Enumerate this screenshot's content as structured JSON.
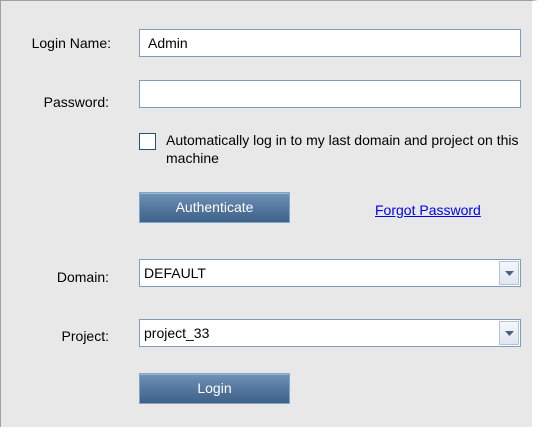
{
  "login": {
    "login_name_label": "Login Name:",
    "login_name_value": "Admin",
    "password_label": "Password:",
    "password_value": "",
    "auto_login_text": "Automatically log in to my last domain and project on this machine",
    "authenticate_label": "Authenticate",
    "forgot_password_label": "Forgot Password",
    "domain_label": "Domain:",
    "domain_value": "DEFAULT",
    "project_label": "Project:",
    "project_value": "project_33",
    "login_button_label": "Login"
  },
  "colors": {
    "panel_background": "#e8e8e8",
    "button_blue": "#55789f",
    "link_blue": "#0000ee"
  },
  "icons": {
    "dropdown": "chevron-down-icon"
  }
}
